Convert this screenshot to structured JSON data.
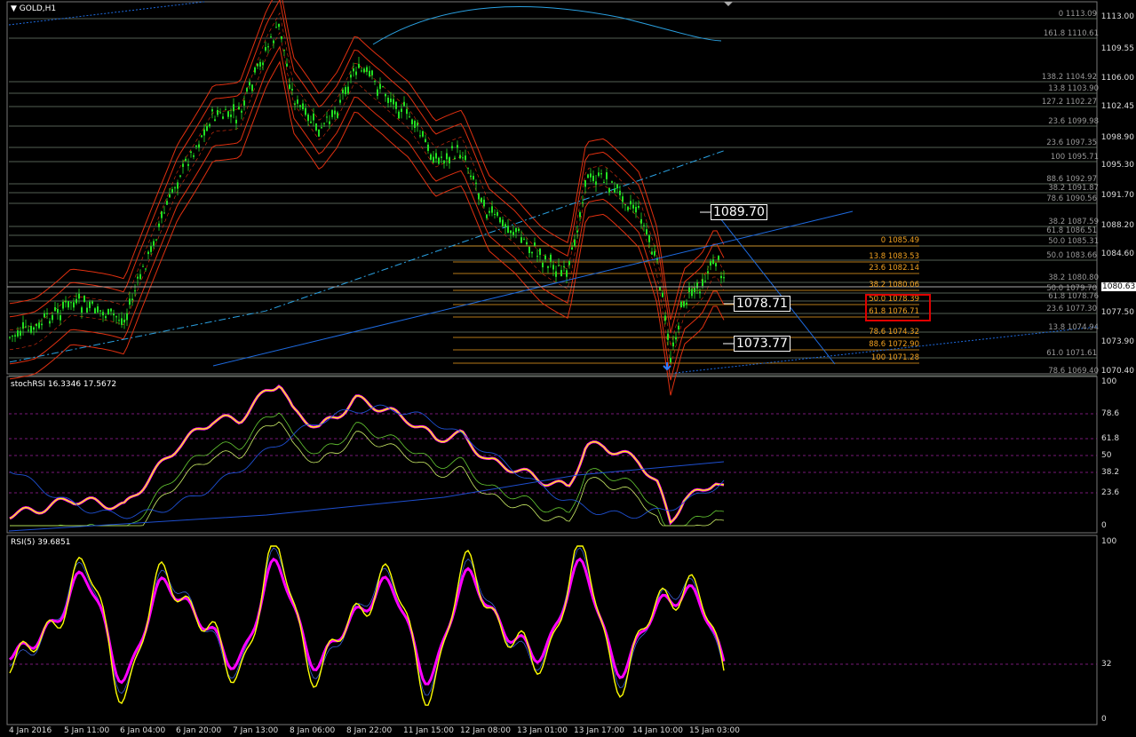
{
  "window": {
    "symbol_label": "GOLD,H1"
  },
  "panels": {
    "stoch_title": "stochRSI 16.3346 17.5672",
    "rsi_title": "RSI(5) 39.6851"
  },
  "price_axis": [
    "1113.00",
    "1109.55",
    "1106.00",
    "1102.45",
    "1098.90",
    "1095.30",
    "1091.70",
    "1088.20",
    "1084.60",
    "1080.63",
    "1077.50",
    "1073.90",
    "1070.40"
  ],
  "current_price": "1080.63",
  "stoch_axis": [
    "100",
    "78.6",
    "61.8",
    "50",
    "38.2",
    "23.6",
    "0"
  ],
  "rsi_axis": [
    "100",
    "32",
    "0"
  ],
  "time_axis": [
    "4 Jan 2016",
    "5 Jan 11:00",
    "6 Jan 04:00",
    "6 Jan 20:00",
    "7 Jan 13:00",
    "8 Jan 06:00",
    "8 Jan 22:00",
    "11 Jan 15:00",
    "12 Jan 08:00",
    "13 Jan 01:00",
    "13 Jan 17:00",
    "14 Jan 10:00",
    "15 Jan 03:00"
  ],
  "fib_upper": [
    "0 1113.09",
    "161.8 1110.61",
    "138.2 1104.92",
    "13.8 1103.90",
    "127.2 1102.27",
    "23.6 1099.98",
    "23.6 1097.35",
    "100 1095.71",
    "88.6 1092.97",
    "38.2 1091.87",
    "78.6 1090.56",
    "38.2 1087.59",
    "61.8 1086.51",
    "50.0 1085.31",
    "50.0 1083.66",
    "38.2 1080.80",
    "50.0 1079.70",
    "61.8 1078.76",
    "23.6 1077.30",
    "13.8 1074.94",
    "61.0 1071.61",
    "78.6 1069.40"
  ],
  "fib_orange": [
    "0 1085.49",
    "13.8 1083.53",
    "23.6 1082.14",
    "38.2 1080.06",
    "50.0 1078.39",
    "61.8 1076.71",
    "78.6 1074.32",
    "88.6 1072.90",
    "100 1071.28"
  ],
  "price_boxes": [
    "1089.70",
    "1078.71",
    "1073.77"
  ],
  "colors": {
    "candle": "#22e022",
    "band_red": "#e03010",
    "ma_blue": "#1e6be0",
    "stoch_k": "#ffff00",
    "stoch_d": "#ff00ff",
    "fib_orange": "#f0a020"
  }
}
